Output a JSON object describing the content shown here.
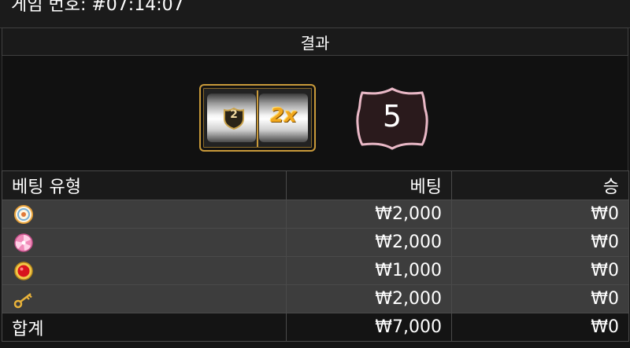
{
  "header": {
    "game_number": "게임 번호: #07:14:07"
  },
  "result": {
    "title": "결과",
    "reel_number": "2",
    "reel_multiplier": "2x",
    "result_number": "5"
  },
  "bets_table": {
    "headers": [
      "베팅 유형",
      "베팅",
      "승"
    ],
    "rows": [
      {
        "icon": "target-icon",
        "bet": "₩2,000",
        "win": "₩0"
      },
      {
        "icon": "candy-icon",
        "bet": "₩2,000",
        "win": "₩0"
      },
      {
        "icon": "red-gem-icon",
        "bet": "₩1,000",
        "win": "₩0"
      },
      {
        "icon": "key-icon",
        "bet": "₩2,000",
        "win": "₩0"
      }
    ],
    "total": {
      "label": "합계",
      "bet": "₩7,000",
      "win": "₩0"
    }
  },
  "colors": {
    "gold": "#c99a3a",
    "shield_pink": "#e9b8c6",
    "shield_fill": "#2a1a1c"
  }
}
